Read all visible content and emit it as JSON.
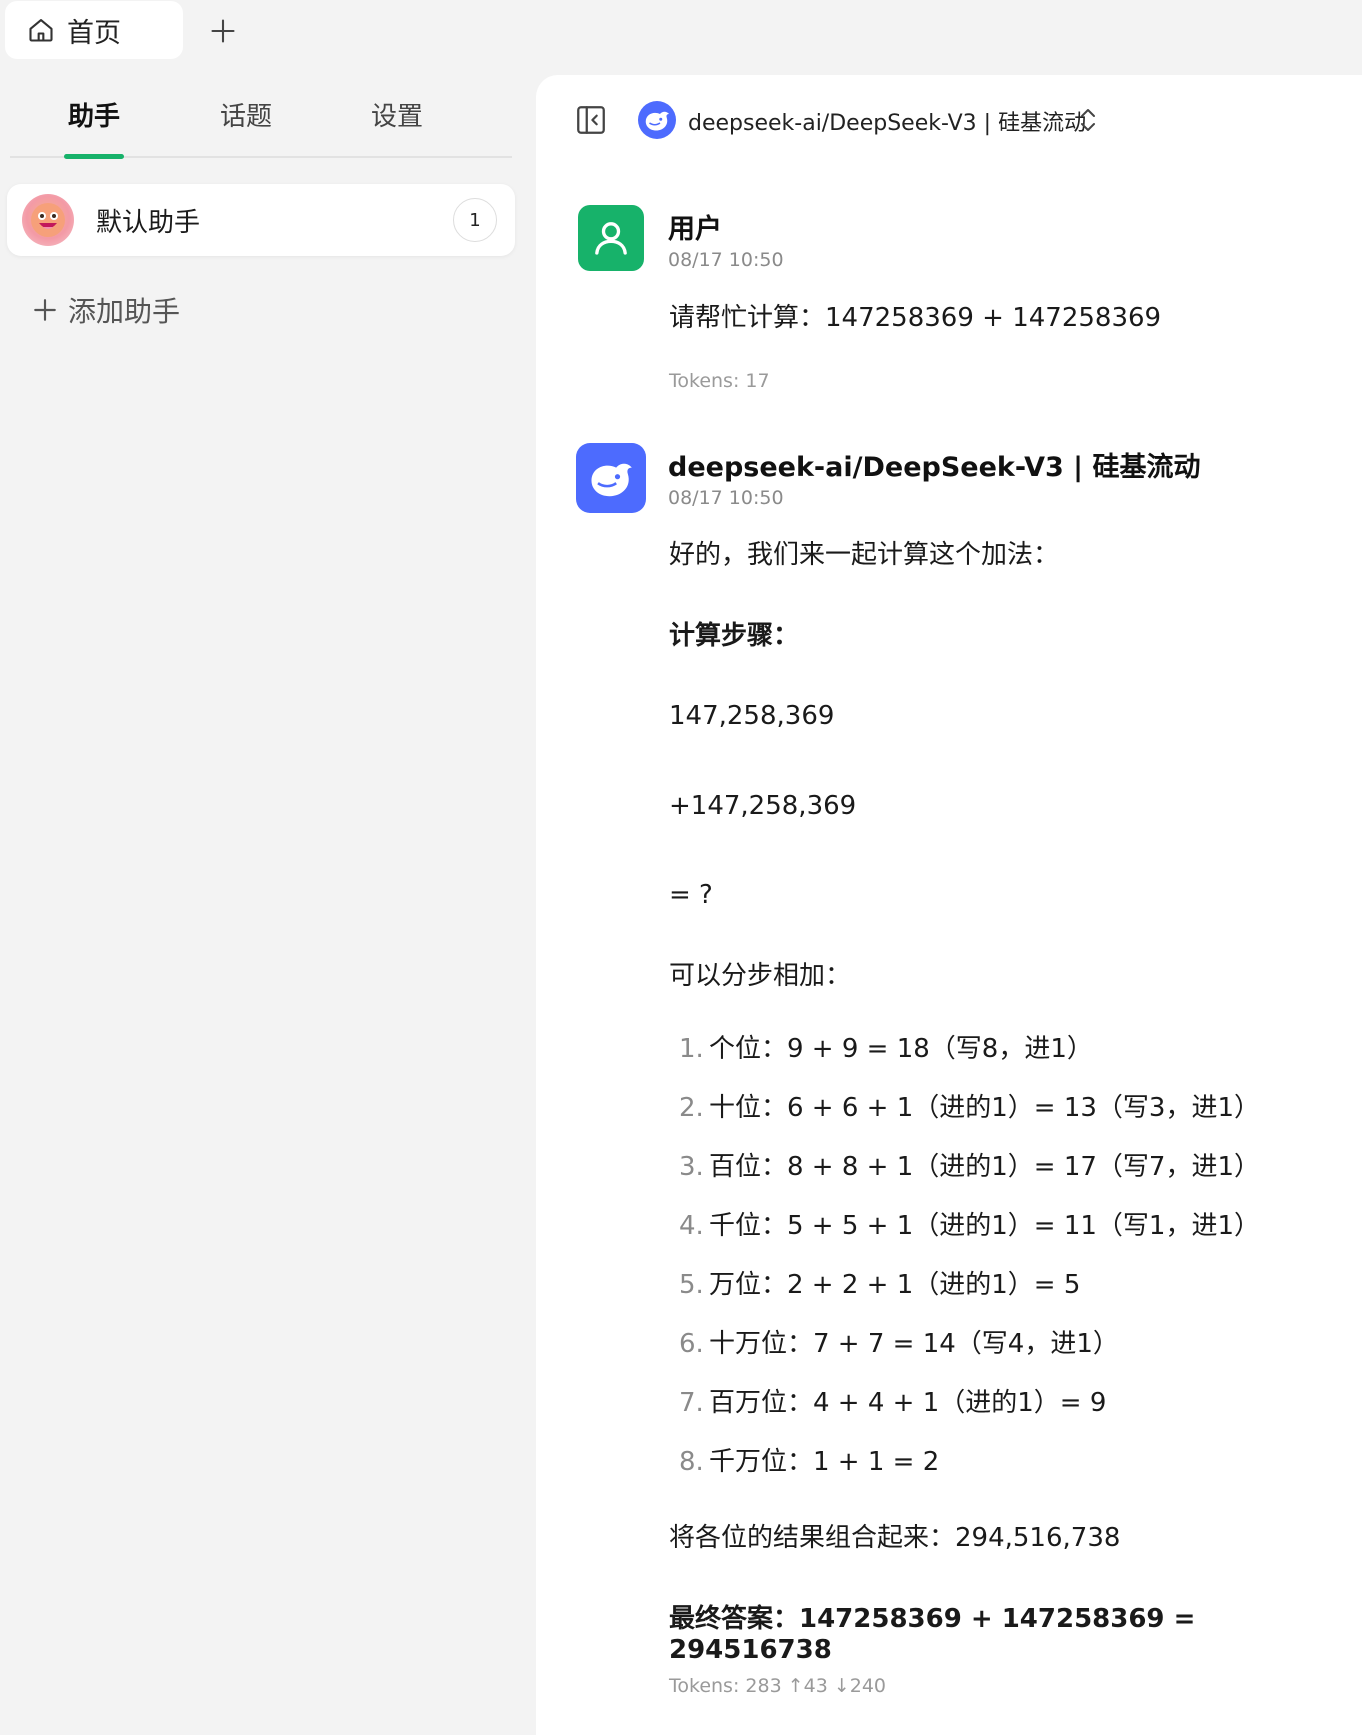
{
  "tabbar": {
    "home_label": "首页"
  },
  "sidebar": {
    "tabs": [
      "助手",
      "话题",
      "设置"
    ],
    "assistant": {
      "name": "默认助手",
      "count": "1"
    },
    "add_label": "添加助手"
  },
  "header": {
    "model_name": "deepseek-ai/DeepSeek-V3 | 硅基流动"
  },
  "messages": {
    "user": {
      "author": "用户",
      "time": "08/17 10:50",
      "text": "请帮忙计算：147258369 + 147258369",
      "tokens": "Tokens: 17"
    },
    "ai": {
      "author": "deepseek-ai/DeepSeek-V3 | 硅基流动",
      "time": "08/17 10:50",
      "intro": "好的，我们来一起计算这个加法：",
      "steps_title": "计算步骤：",
      "line1": "147,258,369",
      "line2": "+147,258,369",
      "line3": "= ?",
      "stepwise": "可以分步相加：",
      "steps": [
        {
          "num": "1.",
          "text": "个位：9 + 9 = 18（写8，进1）"
        },
        {
          "num": "2.",
          "text": "十位：6 + 6 + 1（进的1）= 13（写3，进1）"
        },
        {
          "num": "3.",
          "text": "百位：8 + 8 + 1（进的1）= 17（写7，进1）"
        },
        {
          "num": "4.",
          "text": "千位：5 + 5 + 1（进的1）= 11（写1，进1）"
        },
        {
          "num": "5.",
          "text": "万位：2 + 2 + 1（进的1）= 5"
        },
        {
          "num": "6.",
          "text": "十万位：7 + 7 = 14（写4，进1）"
        },
        {
          "num": "7.",
          "text": "百万位：4 + 4 + 1（进的1）= 9"
        },
        {
          "num": "8.",
          "text": "千万位：1 + 1 = 2"
        }
      ],
      "combine": "将各位的结果组合起来：294,516,738",
      "final": "最终答案：147258369 + 147258369 = 294516738",
      "tokens": "Tokens: 283  ↑43  ↓240"
    }
  },
  "colors": {
    "accent": "#17b26a",
    "model": "#4d6bfe"
  }
}
